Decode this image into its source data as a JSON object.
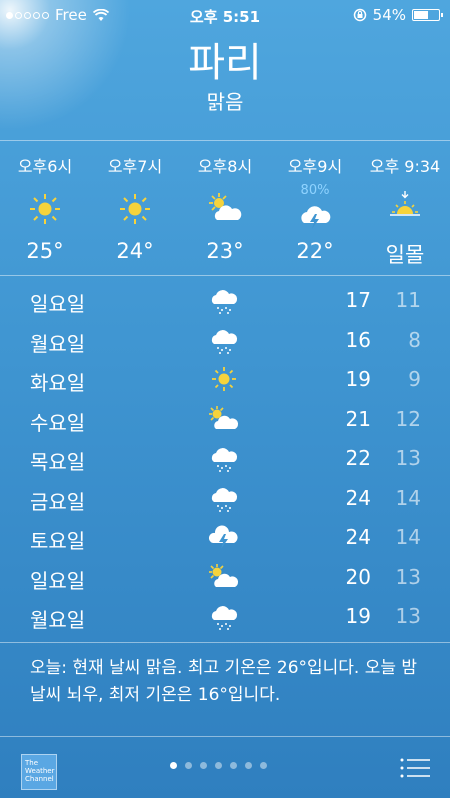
{
  "status": {
    "carrier": "Free",
    "time": "오후 5:51",
    "battery_pct": "54%",
    "battery_level": 0.54,
    "signal_bars": 1,
    "icons": [
      "wifi-icon",
      "orientation-lock-icon",
      "battery-icon"
    ]
  },
  "location": {
    "city": "파리",
    "condition": "맑음"
  },
  "hourly": [
    {
      "time": "오후6시",
      "icon": "sun-icon",
      "temp": "25°",
      "pct": ""
    },
    {
      "time": "오후7시",
      "icon": "sun-icon",
      "temp": "24°",
      "pct": ""
    },
    {
      "time": "오후8시",
      "icon": "partly-cloudy-icon",
      "temp": "23°",
      "pct": ""
    },
    {
      "time": "오후9시",
      "icon": "thunderstorm-icon",
      "temp": "22°",
      "pct": "80%"
    },
    {
      "time": "오후 9:34",
      "icon": "sunset-icon",
      "temp": "일몰",
      "pct": ""
    }
  ],
  "daily": [
    {
      "day": "일요일",
      "icon": "rain-icon",
      "high": "17",
      "low": "11"
    },
    {
      "day": "월요일",
      "icon": "rain-icon",
      "high": "16",
      "low": "8"
    },
    {
      "day": "화요일",
      "icon": "sun-icon",
      "high": "19",
      "low": "9"
    },
    {
      "day": "수요일",
      "icon": "partly-cloudy-icon",
      "high": "21",
      "low": "12"
    },
    {
      "day": "목요일",
      "icon": "rain-icon",
      "high": "22",
      "low": "13"
    },
    {
      "day": "금요일",
      "icon": "rain-icon",
      "high": "24",
      "low": "14"
    },
    {
      "day": "토요일",
      "icon": "thunderstorm-icon",
      "high": "24",
      "low": "14"
    },
    {
      "day": "일요일",
      "icon": "partly-cloudy-icon",
      "high": "20",
      "low": "13"
    },
    {
      "day": "월요일",
      "icon": "rain-icon",
      "high": "19",
      "low": "13"
    }
  ],
  "summary": "오늘: 현재 날씨 맑음. 최고 기온은 26°입니다. 오늘 밤 날씨 뇌우, 최저 기온은 16°입니다.",
  "footer": {
    "logo_line1": "The",
    "logo_line2": "Weather",
    "logo_line3": "Channel",
    "page_count": 7,
    "active_page": 0
  },
  "colors": {
    "sun": "#f6d33c",
    "precip_pct": "#8fd3ff",
    "background": "#3f95d1"
  }
}
